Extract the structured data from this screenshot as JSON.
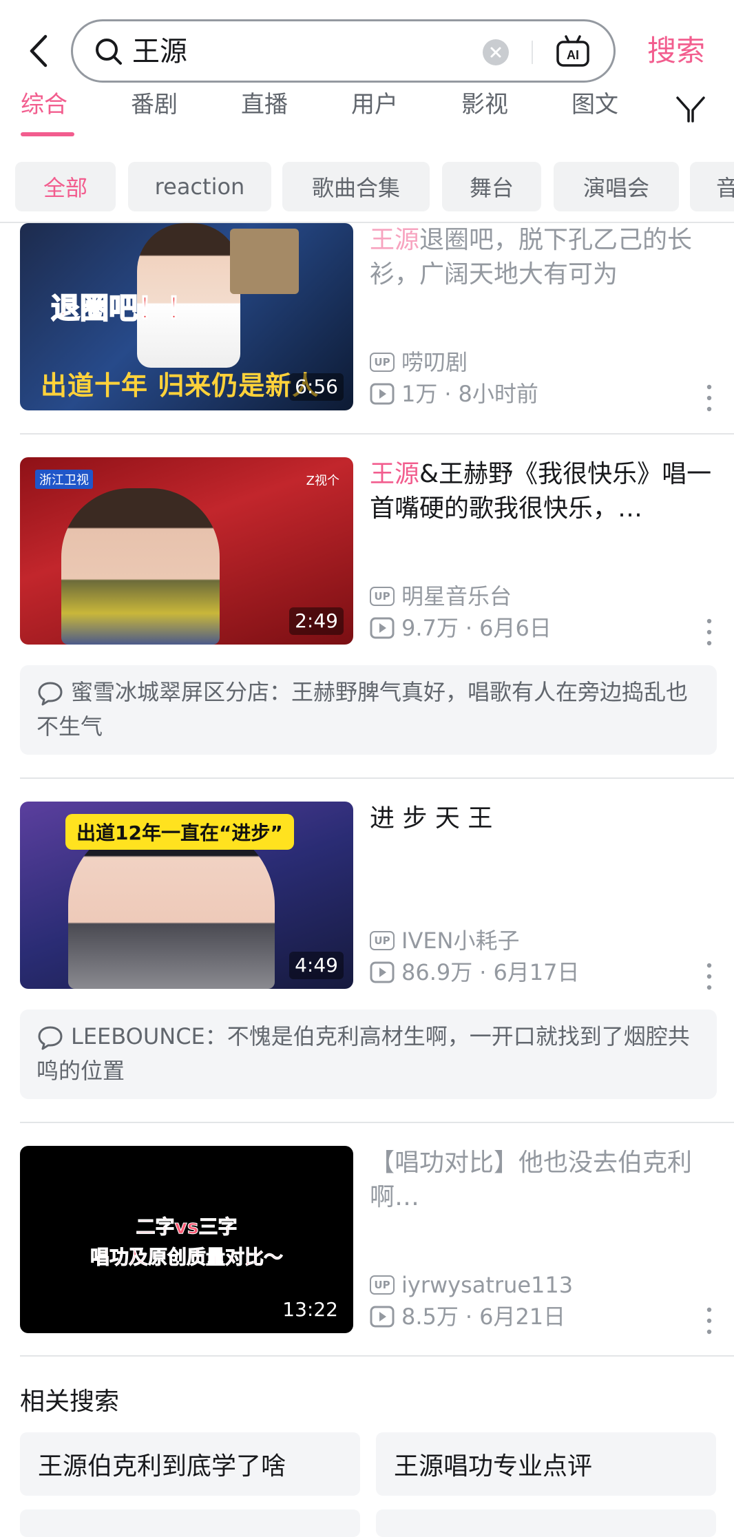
{
  "search": {
    "query": "王源",
    "submit_label": "搜索"
  },
  "tabs": [
    {
      "label": "综合",
      "active": true
    },
    {
      "label": "番剧"
    },
    {
      "label": "直播"
    },
    {
      "label": "用户"
    },
    {
      "label": "影视"
    },
    {
      "label": "图文"
    }
  ],
  "filters": [
    {
      "label": "全部",
      "active": true
    },
    {
      "label": "reaction"
    },
    {
      "label": "歌曲合集"
    },
    {
      "label": "舞台"
    },
    {
      "label": "演唱会"
    },
    {
      "label": "音"
    }
  ],
  "videos": [
    {
      "title_highlight": "王源",
      "title_rest": "退圈吧，脱下孔乙己的长衫，广阔天地大有可为",
      "thumb_caption1": "退圈吧！！",
      "thumb_caption2": "出道十年 归来仍是新人",
      "duration": "6:56",
      "uploader": "唠叨剧",
      "views": "1万",
      "date": "8小时前"
    },
    {
      "title_highlight": "王源",
      "title_rest": "&王赫野《我很快乐》唱一首嘴硬的歌我很快乐，…",
      "thumb_logo": "浙江卫视",
      "thumb_tag": "Z视个",
      "duration": "2:49",
      "uploader": "明星音乐台",
      "views": "9.7万",
      "date": "6月6日",
      "comment": "蜜雪冰城翠屏区分店：王赫野脾气真好，唱歌有人在旁边捣乱也不生气"
    },
    {
      "title_highlight": "",
      "title_rest": "进 步 天 王",
      "thumb_caption1": "出道12年一直在“进步”",
      "duration": "4:49",
      "uploader": "IVEN小耗子",
      "views": "86.9万",
      "date": "6月17日",
      "comment": "LEEBOUNCE：不愧是伯克利高材生啊，一开口就找到了烟腔共鸣的位置"
    },
    {
      "title_highlight": "",
      "title_rest": "【唱功对比】他也没去伯克利啊…",
      "thumb_caption1": "二字vs三字",
      "thumb_caption2": "唱功及原创质量对比～",
      "duration": "13:22",
      "uploader": "iyrwysatrue113",
      "views": "8.5万",
      "date": "6月21日"
    }
  ],
  "related": {
    "title": "相关搜索",
    "items": [
      "王源伯克利到底学了啥",
      "王源唱功专业点评"
    ]
  },
  "colors": {
    "accent": "#f25d8e",
    "text": "#18191c",
    "muted": "#9499a0"
  }
}
